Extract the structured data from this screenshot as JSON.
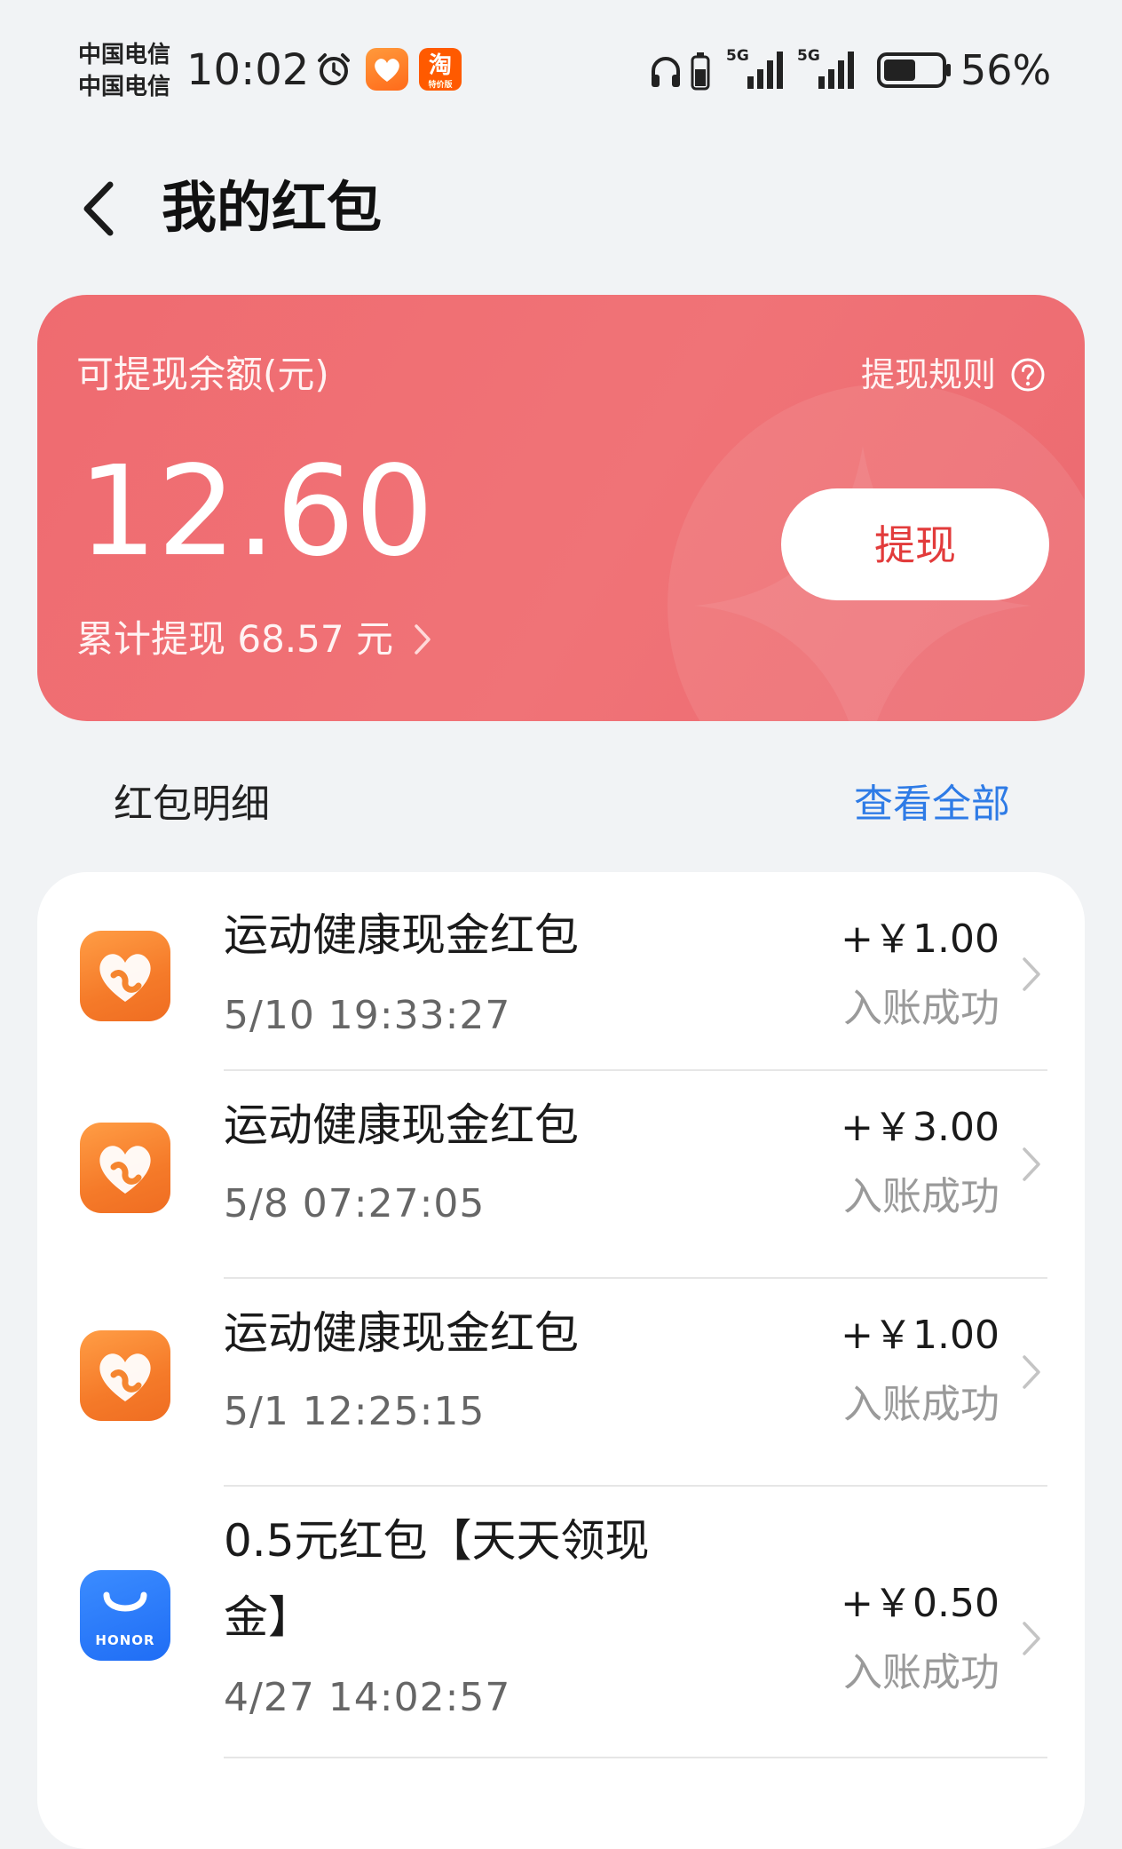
{
  "status_bar": {
    "carrier_1": "中国电信",
    "carrier_2": "中国电信",
    "time": "10:02",
    "taobao_badge": "淘",
    "taobao_badge_sub": "特价版",
    "battery_percent": "56%",
    "battery_level": 0.56
  },
  "header": {
    "title": "我的红包"
  },
  "balance_card": {
    "label": "可提现余额(元)",
    "rules_label": "提现规则",
    "amount": "12.60",
    "total_withdrawn": "累计提现 68.57 元",
    "withdraw_button": "提现",
    "accent_color": "#ef6b70"
  },
  "details": {
    "section_title": "红包明细",
    "view_all_label": "查看全部",
    "items": [
      {
        "icon": "health-heart-icon",
        "title": "运动健康现金红包",
        "time": "5/10 19:33:27",
        "amount": "+￥1.00",
        "status": "入账成功"
      },
      {
        "icon": "health-heart-icon",
        "title": "运动健康现金红包",
        "time": "5/8 07:27:05",
        "amount": "+￥3.00",
        "status": "入账成功"
      },
      {
        "icon": "health-heart-icon",
        "title": "运动健康现金红包",
        "time": "5/1 12:25:15",
        "amount": "+￥1.00",
        "status": "入账成功"
      },
      {
        "icon": "honor-store-icon",
        "icon_text": "HONOR",
        "title": "0.5元红包【天天领现金】",
        "time": "4/27 14:02:57",
        "amount": "+￥0.50",
        "status": "入账成功"
      }
    ]
  }
}
